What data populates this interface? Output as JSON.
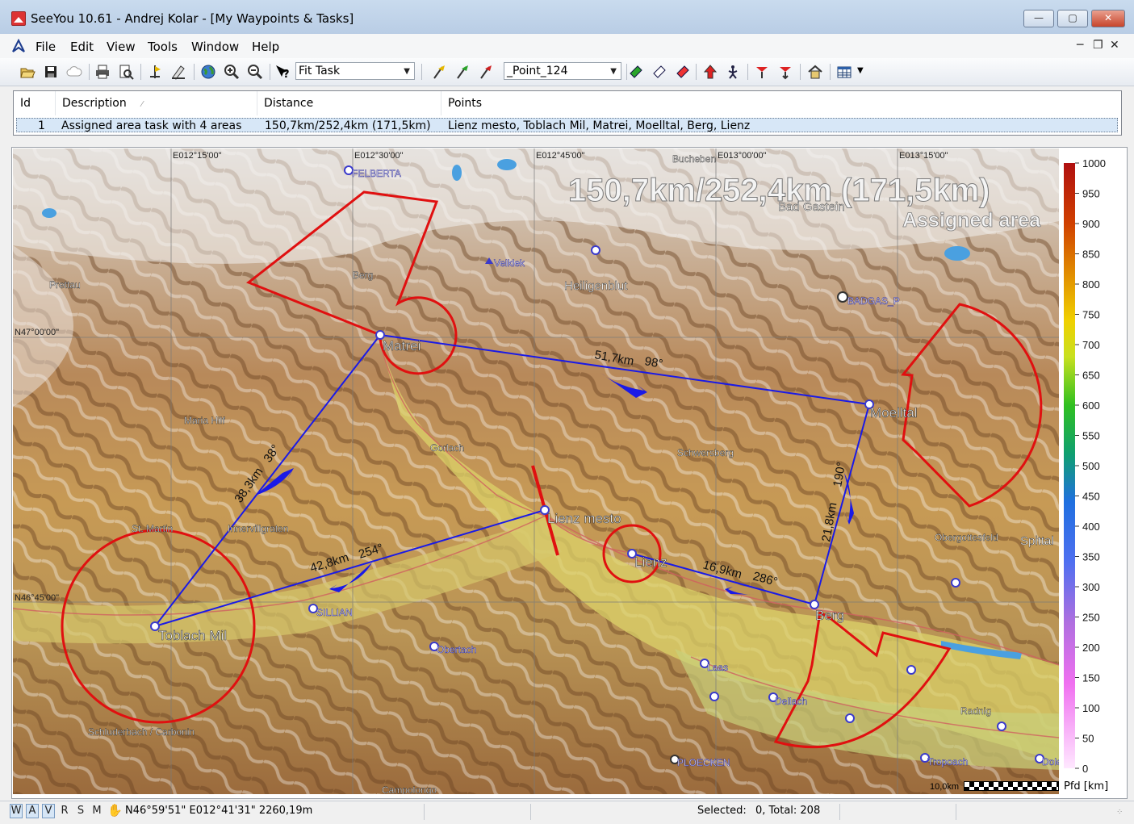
{
  "window": {
    "title": "SeeYou 10.61 - Andrej Kolar - [My Waypoints & Tasks]",
    "controls": [
      "minimize",
      "maximize",
      "close"
    ]
  },
  "menu": {
    "items": [
      "File",
      "Edit",
      "View",
      "Tools",
      "Window",
      "Help"
    ],
    "mdi_controls": [
      "minimize-child",
      "restore-child",
      "close-child"
    ]
  },
  "toolbar": {
    "mode_combo": "Fit Task",
    "point_combo": "_Point_124",
    "icons": [
      "open-folder-icon",
      "save-icon",
      "cloud-icon",
      "print-icon",
      "print-preview-icon",
      "flight-icon",
      "flight-edit-icon",
      "globe-icon",
      "zoom-in-icon",
      "zoom-out-icon",
      "whats-this-icon",
      "waypoint-add-icon",
      "waypoint-edit-icon",
      "waypoint-delete-icon",
      "task-point-add-icon",
      "task-point-insert-icon",
      "task-point-remove-icon",
      "climb-icon",
      "pilot-icon",
      "turnpoint-red-icon",
      "turnpoint-red-down-icon",
      "home-icon",
      "table-view-icon"
    ]
  },
  "task_table": {
    "columns": [
      "Id",
      "Description",
      "Distance",
      "Points"
    ],
    "rows": [
      {
        "id": "1",
        "description": "Assigned area task with 4 areas",
        "distance": "150,7km/252,4km (171,5km)",
        "points": "Lienz mesto, Toblach Mil, Matrei, Moelltal, Berg, Lienz"
      }
    ]
  },
  "map": {
    "task_distance_title": "150,7km/252,4km (171,5km)",
    "task_type_label": "Assigned area",
    "grid_labels": {
      "lon": [
        "E012°15'00\"",
        "E012°30'00\"",
        "E012°45'00\"",
        "E013°00'00\"",
        "E013°15'00\""
      ],
      "lat": [
        "N47°00'00\"",
        "N46°45'00\""
      ]
    },
    "task_points": [
      "Matrei",
      "Moelltal",
      "Lienz mesto",
      "Lienz",
      "Berg",
      "Toblach Mil"
    ],
    "legs": [
      {
        "distance": "51,7km",
        "bearing": "98°"
      },
      {
        "distance": "21,8km",
        "bearing": "190°"
      },
      {
        "distance": "16,9km",
        "bearing": "286°"
      },
      {
        "distance": "42,8km",
        "bearing": "254°"
      },
      {
        "distance": "38,3km",
        "bearing": "38°"
      }
    ],
    "waypoints": [
      "FELBERTA",
      "Velklek",
      "BADGAS_P",
      "SILLIAN",
      "Obertach",
      "Laas",
      "Dellach",
      "PLOECKEN",
      "Tropoach",
      "Dole"
    ],
    "places": [
      "Bucheben",
      "Bad Gastein",
      "Heiligenblut",
      "Prettau",
      "Berg",
      "Maria Hilf",
      "Gorlach",
      "Schwersberg",
      "St. Martin",
      "Innervillgraten",
      "Obergottesfeld",
      "Spittal",
      "Radnig",
      "Schluderbach / Carbonin",
      "Campolongo"
    ],
    "scale_label": "10,0km",
    "colors": {
      "task_line": "#1a1ae6",
      "sectors": "#e01010",
      "waypoints": "#3a3acc"
    }
  },
  "legend": {
    "ticks": [
      "1000",
      "950",
      "900",
      "850",
      "800",
      "750",
      "700",
      "650",
      "600",
      "550",
      "500",
      "450",
      "400",
      "350",
      "300",
      "250",
      "200",
      "150",
      "100",
      "50",
      "0"
    ],
    "unit": "Pfd [km]"
  },
  "status": {
    "modes": [
      "W",
      "A",
      "V",
      "R",
      "S",
      "M"
    ],
    "active_modes": [
      "W",
      "A",
      "V"
    ],
    "coords": "N46°59'51\"  E012°41'31\" 2260,19m",
    "selected_label": "Selected:",
    "selected_value": "0, Total:  208"
  }
}
